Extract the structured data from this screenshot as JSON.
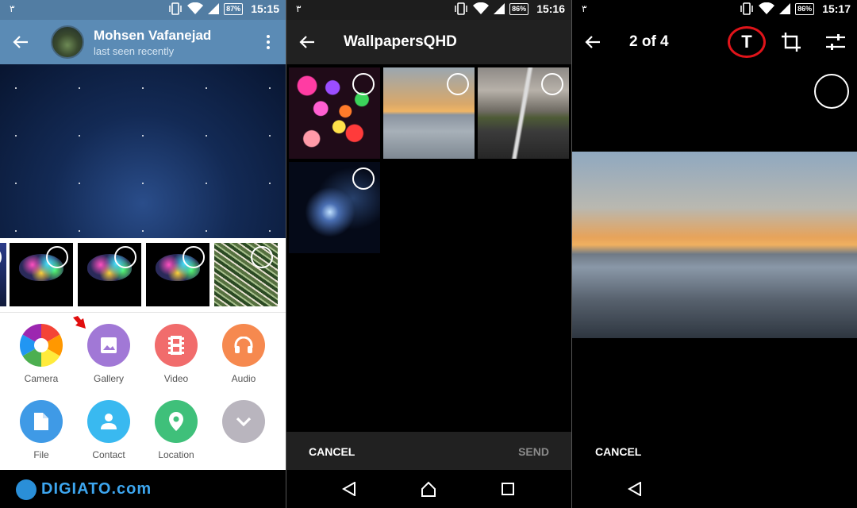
{
  "panel_telegram": {
    "status": {
      "lead": "۳",
      "battery": "87%",
      "time": "15:15"
    },
    "header": {
      "name": "Mohsen Vafanejad",
      "subtitle": "last seen recently"
    },
    "attach": [
      {
        "label": "Camera",
        "color": "#ffffff",
        "icon": "camera-aperture-icon"
      },
      {
        "label": "Gallery",
        "color": "#a178d6",
        "icon": "image-icon"
      },
      {
        "label": "Video",
        "color": "#f16c6c",
        "icon": "film-icon"
      },
      {
        "label": "Audio",
        "color": "#f6894f",
        "icon": "headphones-icon"
      },
      {
        "label": "File",
        "color": "#3f9ae6",
        "icon": "file-icon"
      },
      {
        "label": "Contact",
        "color": "#39b9f0",
        "icon": "person-icon"
      },
      {
        "label": "Location",
        "color": "#3fc07a",
        "icon": "location-pin-icon"
      },
      {
        "label": "",
        "color": "#b9b5be",
        "icon": "chevron-down-icon"
      }
    ],
    "watermark": "DIGIATO.com"
  },
  "panel_gallery": {
    "status": {
      "lead": "۳",
      "battery": "86%",
      "time": "15:16"
    },
    "header": {
      "title": "WallpapersQHD"
    },
    "footer": {
      "cancel": "CANCEL",
      "send": "SEND"
    }
  },
  "panel_editor": {
    "status": {
      "lead": "۳",
      "battery": "86%",
      "time": "15:17"
    },
    "header": {
      "counter": "2 of 4",
      "text_tool": "T"
    },
    "footer": {
      "cancel": "CANCEL"
    }
  },
  "colors": {
    "telegram_header": "#5b8bb5",
    "highlight": "#e0141a",
    "send_disabled": "#8a8a8a",
    "watermark": "#3da6ef"
  }
}
